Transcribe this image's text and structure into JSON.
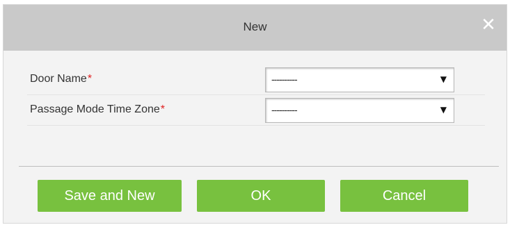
{
  "dialog": {
    "title": "New",
    "close_icon": "close-icon",
    "close_glyph": "✕"
  },
  "form": {
    "fields": [
      {
        "label": "Door Name",
        "required_mark": "*",
        "select_value": "----------",
        "arrow_icon": "dropdown-arrow-icon",
        "arrow_glyph": "▼"
      },
      {
        "label": "Passage Mode Time Zone",
        "required_mark": "*",
        "select_value": "----------",
        "arrow_icon": "dropdown-arrow-icon",
        "arrow_glyph": "▼"
      }
    ]
  },
  "buttons": {
    "save_and_new": "Save and New",
    "ok": "OK",
    "cancel": "Cancel"
  },
  "colors": {
    "titlebar": "#c9c9c9",
    "dialog_background": "#f3f3f3",
    "button_green": "#78c13f",
    "required_red": "#e02020"
  }
}
